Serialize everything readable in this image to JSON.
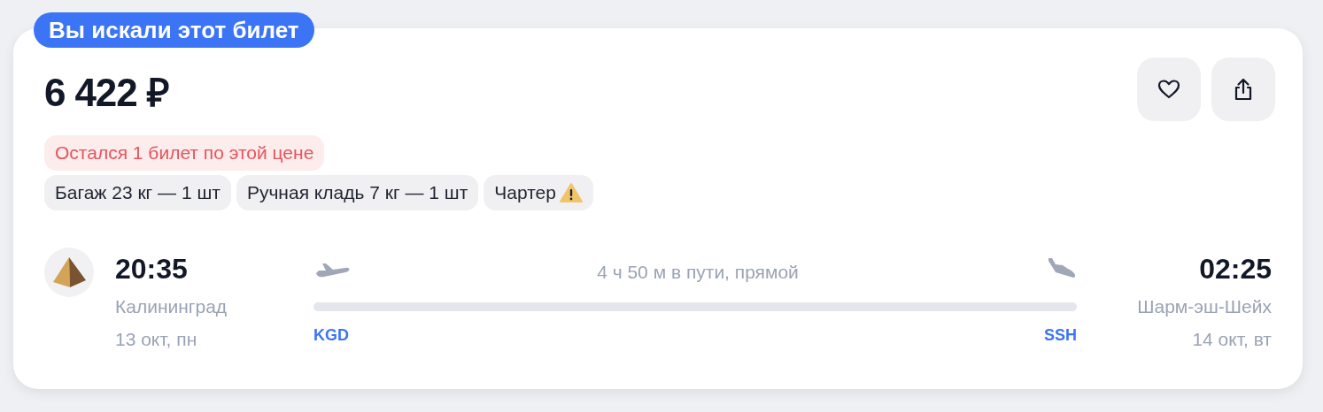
{
  "badge": "Вы искали этот билет",
  "price": "6 422 ₽",
  "actions": [
    {
      "kind": "favorite"
    },
    {
      "kind": "share"
    }
  ],
  "tags": [
    {
      "kind": "alert",
      "label": "Остался 1 билет по этой цене",
      "warning_icon": false
    },
    {
      "kind": "info",
      "label": "Багаж 23 кг — 1 шт",
      "warning_icon": false
    },
    {
      "kind": "info",
      "label": "Ручная кладь 7 кг — 1 шт",
      "warning_icon": false
    },
    {
      "kind": "info",
      "label": "Чартер",
      "warning_icon": true
    }
  ],
  "flight": {
    "departure": {
      "time": "20:35",
      "city": "Калининград",
      "date": "13 окт, пн",
      "code": "KGD"
    },
    "duration": "4 ч 50 м в пути, прямой",
    "arrival": {
      "time": "02:25",
      "city": "Шарм-эш-Шейх",
      "date": "14 окт, вт",
      "code": "SSH"
    }
  }
}
